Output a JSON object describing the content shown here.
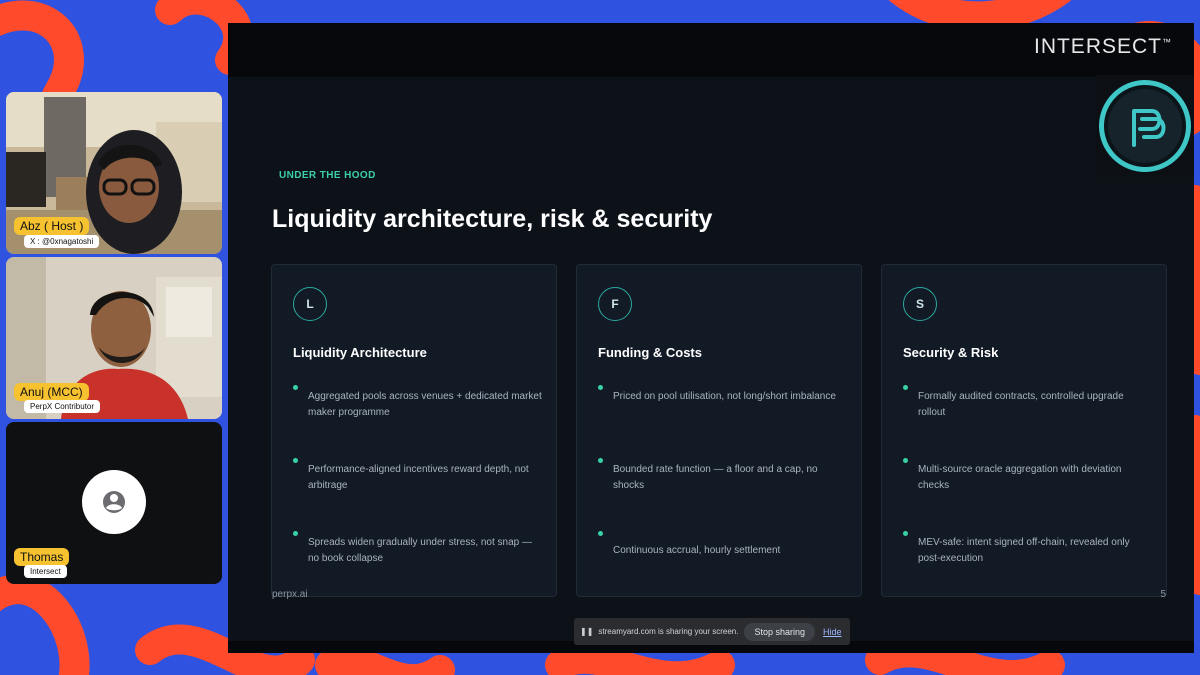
{
  "colors": {
    "background": "#2f52e0",
    "decor": "#ff4b2b",
    "accent": "#3bd1a6",
    "name_tag": "#f6c230",
    "slide": "#0d1219",
    "card": "#121a25"
  },
  "participants": [
    {
      "name": "Abz ( Host )",
      "subtitle": "X : @0xnagatoshi"
    },
    {
      "name": "Anuj (MCC)",
      "subtitle": "PerpX Contributor"
    },
    {
      "name": "Thomas",
      "subtitle": "Intersect"
    }
  ],
  "screen": {
    "brand": "INTERSECT",
    "brand_tm": "™",
    "logo_icon": "perpx-logo-icon"
  },
  "slide": {
    "kicker": "UNDER THE HOOD",
    "title": "Liquidity architecture, risk & security",
    "cards": [
      {
        "letter": "L",
        "title": "Liquidity Architecture",
        "bullets": [
          "Aggregated pools across venues + dedicated market maker programme",
          "Performance-aligned incentives reward depth, not arbitrage",
          "Spreads widen gradually under stress, not snap — no book collapse"
        ]
      },
      {
        "letter": "F",
        "title": "Funding & Costs",
        "bullets": [
          "Priced on pool utilisation, not long/short imbalance",
          "Bounded rate function — a floor and a cap, no shocks",
          "Continuous accrual, hourly settlement"
        ]
      },
      {
        "letter": "S",
        "title": "Security & Risk",
        "bullets": [
          "Formally audited contracts, controlled upgrade rollout",
          "Multi-source oracle aggregation with deviation checks",
          "MEV-safe: intent signed off-chain, revealed only post-execution"
        ]
      }
    ],
    "footer_left": "perpx.ai",
    "page_number": "5"
  },
  "share_bar": {
    "message": "streamyard.com is sharing your screen.",
    "stop_label": "Stop sharing",
    "hide_label": "Hide"
  }
}
